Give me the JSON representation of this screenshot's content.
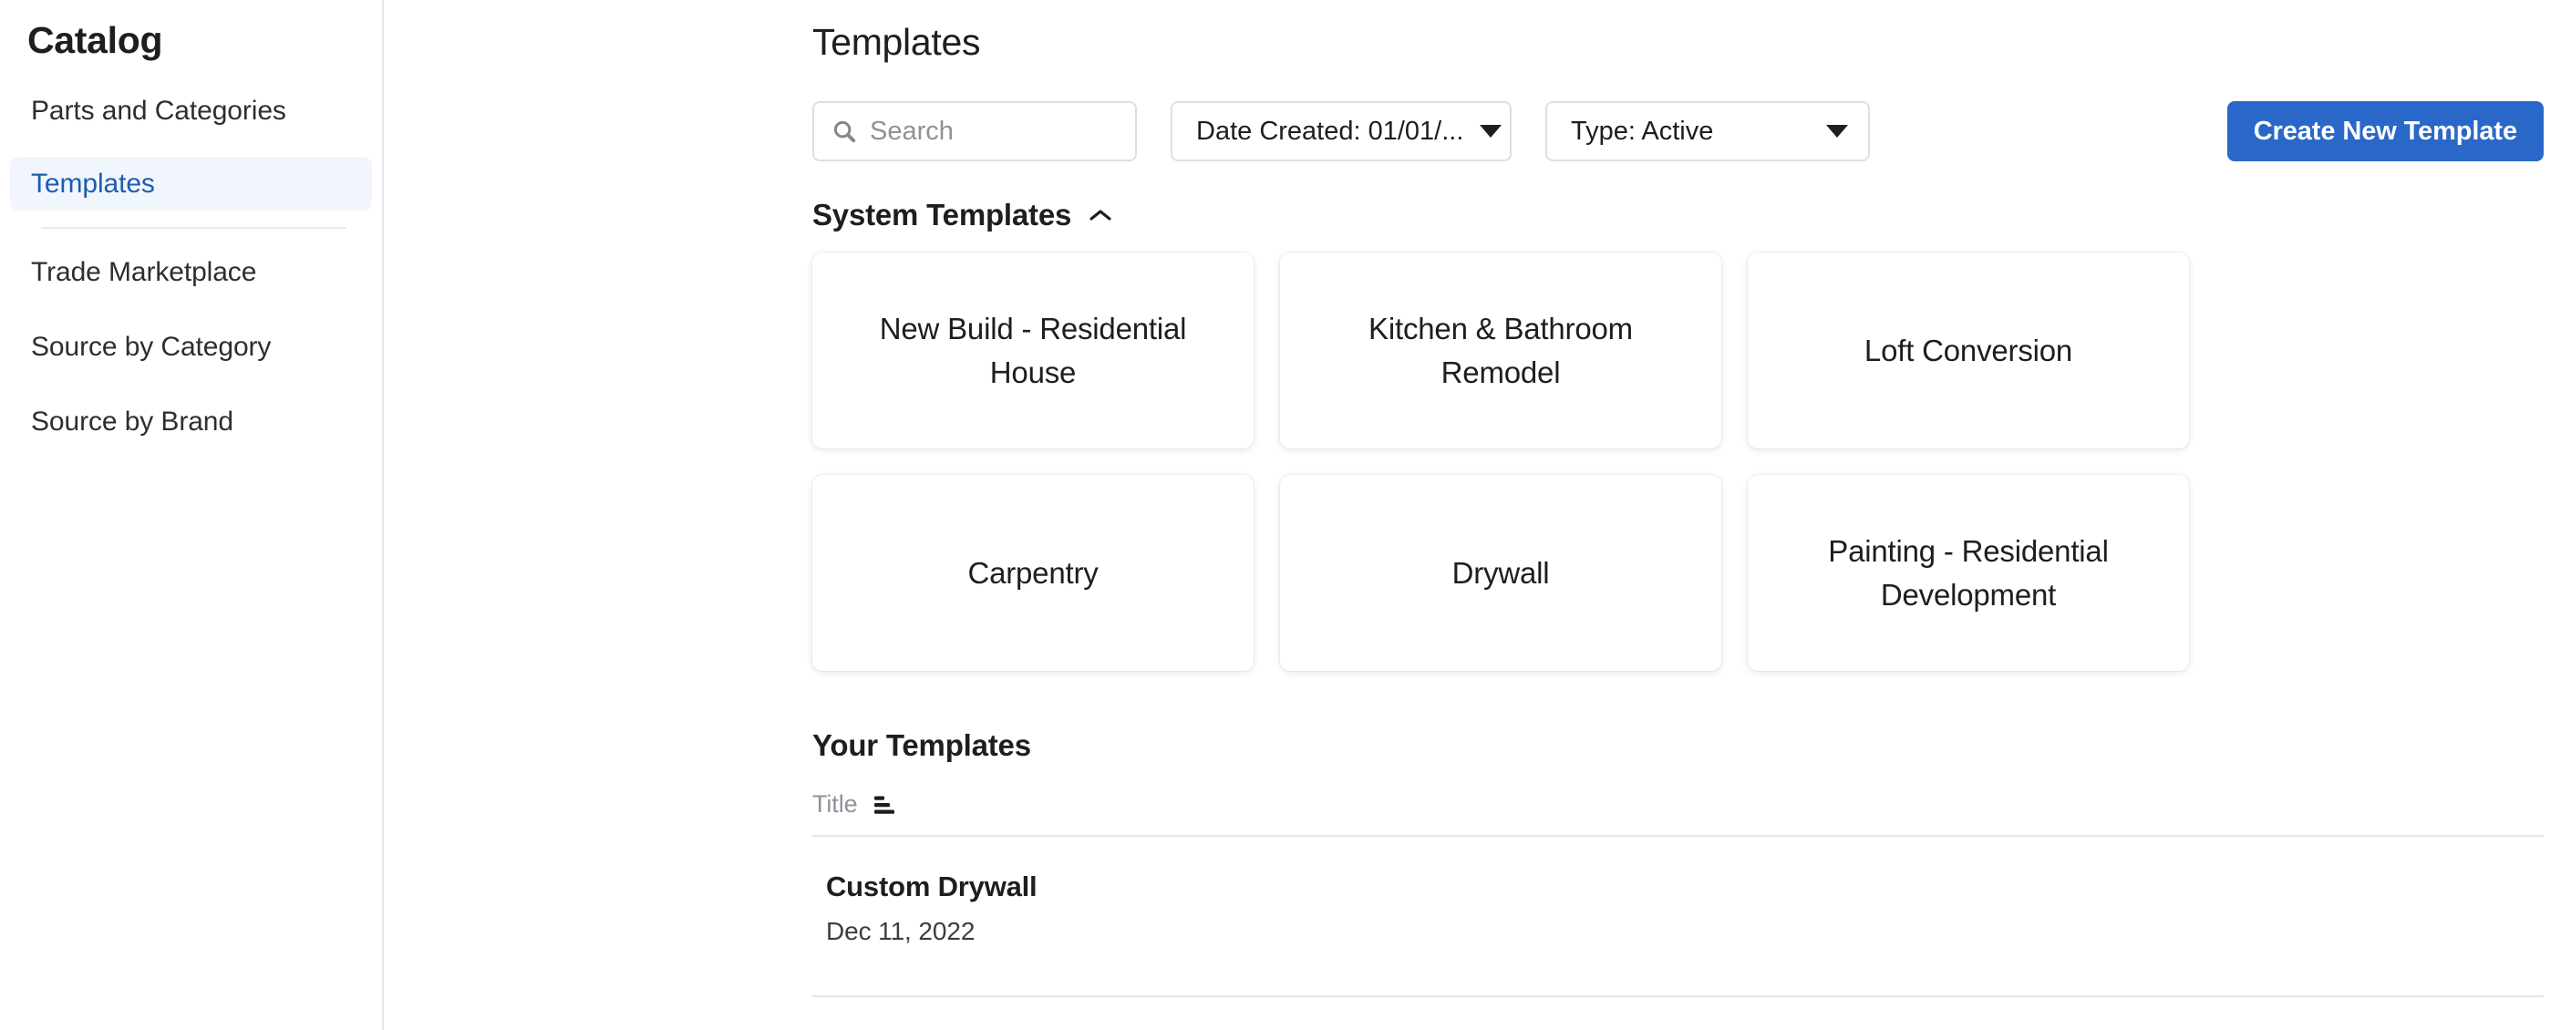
{
  "sidebar": {
    "title": "Catalog",
    "items": [
      {
        "label": "Parts and Categories",
        "active": false
      },
      {
        "label": "Templates",
        "active": true
      },
      {
        "label": "Trade Marketplace",
        "active": false
      },
      {
        "label": "Source by Category",
        "active": false
      },
      {
        "label": "Source by Brand",
        "active": false
      }
    ]
  },
  "main": {
    "page_title": "Templates",
    "toolbar": {
      "search_placeholder": "Search",
      "search_value": "",
      "search_icon": "search-icon",
      "date_filter_label": "Date Created: 01/01/...",
      "type_filter_label": "Type: Active",
      "create_button_label": "Create New Template"
    },
    "system_section": {
      "title": "System Templates",
      "collapse_icon": "chevron-up-icon",
      "cards": [
        {
          "label": "New Build - Residential House"
        },
        {
          "label": "Kitchen & Bathroom Remodel"
        },
        {
          "label": "Loft Conversion"
        },
        {
          "label": "Carpentry"
        },
        {
          "label": "Drywall"
        },
        {
          "label": "Painting - Residential Development"
        }
      ]
    },
    "your_section": {
      "title": "Your Templates",
      "columns": [
        {
          "label": "Title",
          "sort_icon": "sort-icon"
        }
      ],
      "rows": [
        {
          "title": "Custom Drywall",
          "date": "Dec 11, 2022"
        }
      ]
    }
  },
  "colors": {
    "accent": "#2968c8",
    "active_nav_text": "#1f5bb5",
    "active_nav_bg": "#f0f6fb",
    "text": "#1c1e21",
    "muted": "#8d9298",
    "border": "#dcdfe3"
  }
}
